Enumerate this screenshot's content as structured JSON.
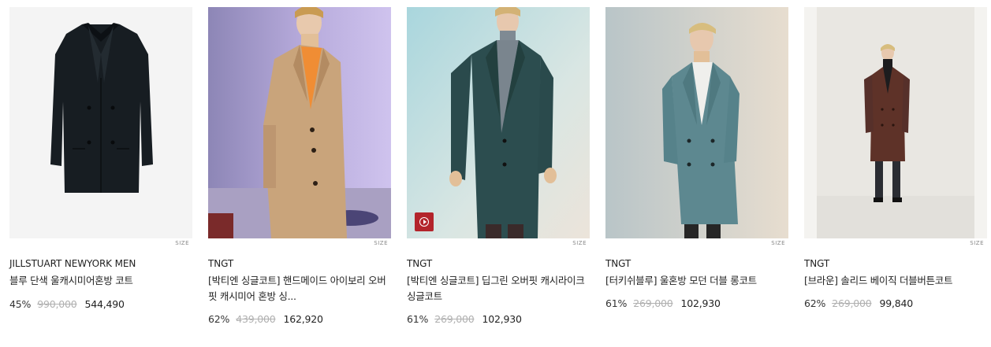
{
  "products": [
    {
      "brand": "JILLSTUART NEWYORK MEN",
      "name": "블루 단색 울캐시미어혼방 코트",
      "discount": "45%",
      "original_price": "990,000",
      "sale_price": "544,490",
      "size_label": "SIZE",
      "image": "navy-wool-overcoat-flatlay",
      "colors": {
        "bg": "#f4f4f4",
        "coat": "#171d22"
      }
    },
    {
      "brand": "TNGT",
      "name": "[박티엔 싱글코트] 핸드메이드 아이보리 오버핏 캐시미어 혼방 싱...",
      "discount": "62%",
      "original_price": "439,000",
      "sale_price": "162,920",
      "size_label": "SIZE",
      "image": "camel-single-coat-model",
      "colors": {
        "bg": "#a79ecf",
        "coat": "#c9a47b"
      }
    },
    {
      "brand": "TNGT",
      "name": "[박티엔 싱글코트] 딥그린 오버핏 캐시라이크 싱글코트",
      "discount": "61%",
      "original_price": "269,000",
      "sale_price": "102,930",
      "size_label": "SIZE",
      "image": "deep-green-single-coat-model",
      "play_icon": "video-play-icon",
      "colors": {
        "bg": "#cfe3e6",
        "coat": "#2c4d4f"
      }
    },
    {
      "brand": "TNGT",
      "name": "[터키쉬블루] 울혼방 모던 더블 롱코트",
      "discount": "61%",
      "original_price": "269,000",
      "sale_price": "102,930",
      "size_label": "SIZE",
      "image": "turkish-blue-double-coat-model",
      "colors": {
        "bg": "#d8d5cc",
        "coat": "#5d8890"
      }
    },
    {
      "brand": "TNGT",
      "name": "[브라운] 솔리드 베이직 더블버튼코트",
      "discount": "62%",
      "original_price": "269,000",
      "sale_price": "99,840",
      "size_label": "SIZE",
      "image": "brown-double-button-coat-model",
      "colors": {
        "bg": "#e9e7e2",
        "coat": "#5e3228"
      }
    }
  ]
}
